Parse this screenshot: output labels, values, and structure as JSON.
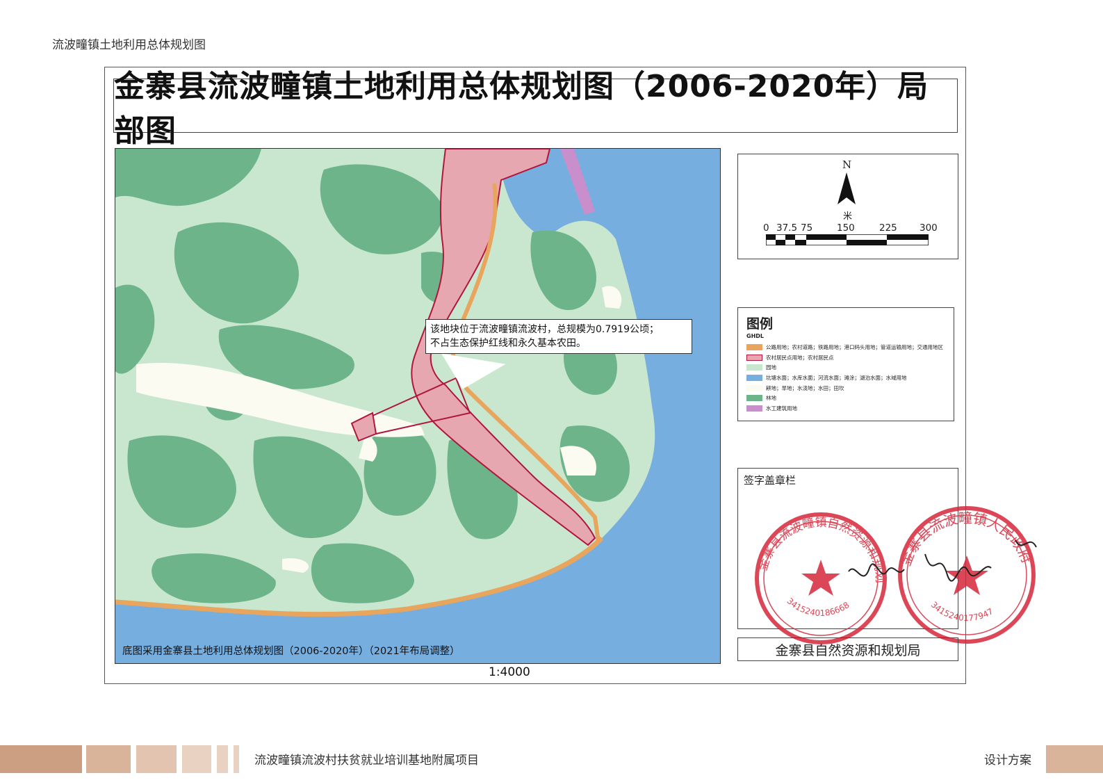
{
  "page_header": "流波疃镇土地利用总体规划图",
  "map": {
    "title": "金寨县流波疃镇土地利用总体规划图（2006-2020年）局部图",
    "annotation": {
      "line1": "该地块位于流波疃镇流波村，总规模为0.7919公顷；",
      "line2": "不占生态保护红线和永久基本农田。"
    },
    "caption": "底图采用金寨县土地利用总体规划图（2006-2020年）（2021年布局调整）",
    "scale_ratio": "1:4000"
  },
  "north": {
    "letter": "N",
    "unit": "米",
    "ticks": [
      "0",
      "37.5",
      "75",
      "150",
      "225",
      "300"
    ]
  },
  "legend": {
    "title": "图例",
    "code": "GHDL",
    "items": [
      {
        "label": "公路用地；农村道路；铁路用地；港口码头用地；管道运输用地；交通用地区",
        "color": "#e8a55e",
        "border": "#e8a55e"
      },
      {
        "label": "农村居民点用地；农村居民点",
        "color": "#e7a7b0",
        "border": "#b0163c"
      },
      {
        "label": "园地",
        "color": "#c9e7cf",
        "border": "#c9e7cf"
      },
      {
        "label": "坑塘水面；水库水面；河流水面；滩涂；湖泊水面；水域用地",
        "color": "#77aee0",
        "border": "#77aee0"
      },
      {
        "label": "耕地；旱地；水浇地；水田；田坎",
        "color": "#fbfbf2",
        "border": "#fbfbf2"
      },
      {
        "label": "林地",
        "color": "#6eb48a",
        "border": "#6eb48a"
      },
      {
        "label": "水工建筑用地",
        "color": "#c88fcc",
        "border": "#c88fcc"
      }
    ]
  },
  "signature": {
    "label": "签字盖章栏",
    "seal_left_text": "金寨县流波疃镇自然资源和规划所",
    "seal_left_number": "3415240186668",
    "seal_right_text": "金寨县流波疃镇人民政府",
    "seal_right_number": "3415240177947"
  },
  "department": "金寨县自然资源和规划局",
  "footer": {
    "project": "流波疃镇流波村扶贫就业培训基地附属项目",
    "section": "设计方案"
  },
  "colors": {
    "forest": "#6eb48a",
    "orchard": "#c9e7cf",
    "water": "#77aee0",
    "settlement": "#e7a7b0",
    "settlement_border": "#b0163c",
    "road": "#e8a55e",
    "hydraulic": "#c88fcc",
    "farmland": "#fbfbf2",
    "seal_red": "#d6283c",
    "footer_bar": "#d9a98a"
  }
}
